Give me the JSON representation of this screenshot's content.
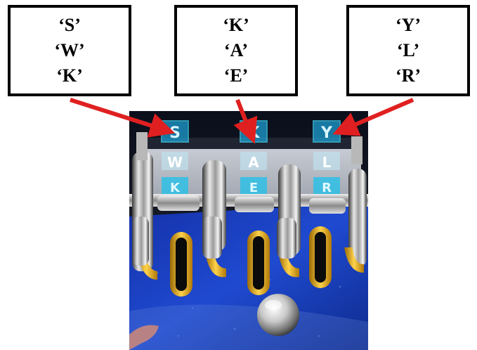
{
  "labels": {
    "left": {
      "line1": "‘S’",
      "line2": "‘W’",
      "line3": "‘K’"
    },
    "mid": {
      "line1": "‘K’",
      "line2": "‘A’",
      "line3": "‘E’"
    },
    "right": {
      "line1": "‘Y’",
      "line2": "‘L’",
      "line3": "‘R’"
    }
  },
  "reels": {
    "left": {
      "top": "S",
      "middle": "W",
      "bottom": "K"
    },
    "mid": {
      "top": "K",
      "middle": "A",
      "bottom": "E"
    },
    "right": {
      "top": "Y",
      "middle": "L",
      "bottom": "R"
    }
  },
  "colors": {
    "arrow": "#e02020",
    "reel_frame": "#3fd0f0",
    "playfield": "#1a3fb0",
    "lane_gold": "#e2a514"
  },
  "icons": {
    "arrow": "red-arrow-icon",
    "ball": "silver-pinball-icon"
  }
}
